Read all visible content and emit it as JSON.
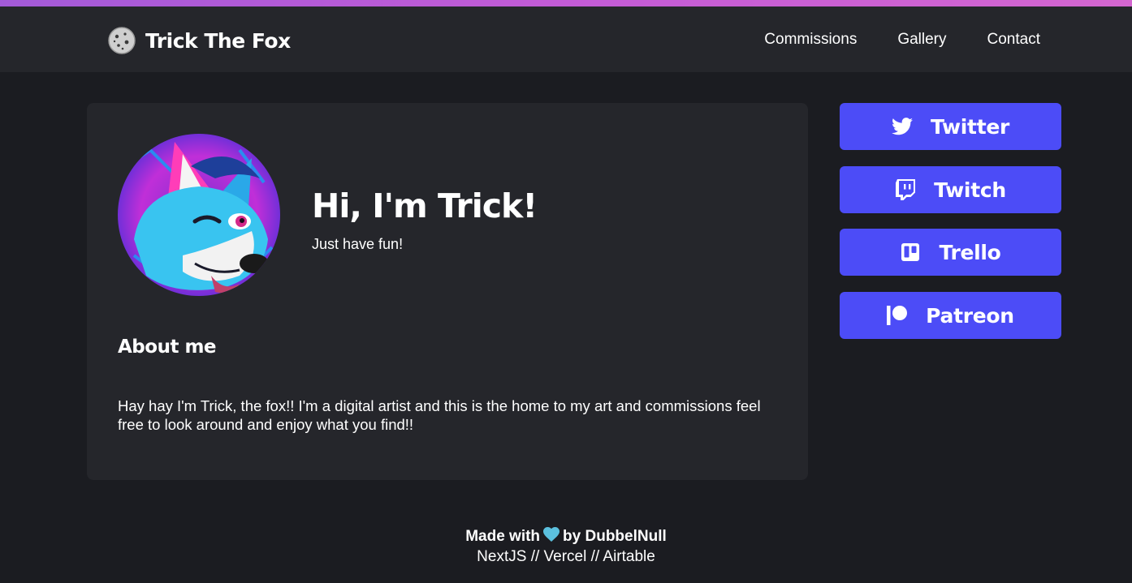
{
  "header": {
    "brand_title": "Trick The Fox",
    "nav": [
      "Commissions",
      "Gallery",
      "Contact"
    ]
  },
  "profile": {
    "greeting": "Hi, I'm Trick!",
    "tagline": "Just have fun!",
    "about_heading": "About me",
    "about_text": "Hay hay I'm Trick, the fox!! I'm a digital artist and this is the home to my art and commissions feel free to look around and enjoy what you find!!"
  },
  "socials": [
    {
      "label": "Twitter",
      "icon": "twitter-icon"
    },
    {
      "label": "Twitch",
      "icon": "twitch-icon"
    },
    {
      "label": "Trello",
      "icon": "trello-icon"
    },
    {
      "label": "Patreon",
      "icon": "patreon-icon"
    }
  ],
  "footer": {
    "made_with": "Made with",
    "by": "by DubbelNull",
    "stack": "NextJS // Vercel // Airtable"
  },
  "colors": {
    "accent_bar": "#c35bd6",
    "button": "#4c4cf7",
    "card": "#25262b",
    "background": "#1b1c21",
    "heart": "#5bc0de"
  }
}
